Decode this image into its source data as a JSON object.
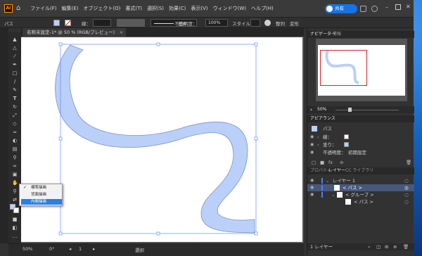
{
  "menubar": {
    "app_logo": "Ai",
    "items": [
      "ファイル(F)",
      "編集(E)",
      "オブジェクト(O)",
      "書式(T)",
      "選択(S)",
      "効果(C)",
      "表示(V)",
      "ウィンドウ(W)",
      "ヘルプ(H)"
    ],
    "share_label": "共有"
  },
  "control": {
    "object_label": "パス",
    "stroke_label": "線：",
    "stroke_style": "基本",
    "opacity_label": "不透明度：",
    "opacity_value": "100%",
    "style_label": "スタイル：",
    "align_label": "整列",
    "transform_label": "変形"
  },
  "document": {
    "tab_title": "名称未設定-1* @ 50 % (RGB/プレビュー)",
    "tab_close": "×"
  },
  "draw_mode_menu": {
    "options": [
      "標準描画",
      "背面描画",
      "内側描画"
    ],
    "checked_index": 0,
    "selected_index": 2
  },
  "status_bar": {
    "zoom": "50%",
    "rotation": "0°",
    "artboard_number": "1",
    "tool_name": "選択"
  },
  "navigator": {
    "tab_navigator": "ナビゲーター",
    "tab_info": "情報",
    "zoom": "50%"
  },
  "appearance": {
    "tab_label": "アピアランス",
    "object_label": "パス",
    "stroke_label": "線：",
    "fill_label": "塗り：",
    "opacity_label": "不透明度：",
    "opacity_value": "初期設定"
  },
  "layers": {
    "tab_properties": "プロパティ",
    "tab_layers": "レイヤー",
    "tab_libraries": "CC ライブラリ",
    "items": [
      {
        "name": "レイヤー 1",
        "level": 0
      },
      {
        "name": "< パス >",
        "level": 1
      },
      {
        "name": "< グループ >",
        "level": 1
      },
      {
        "name": "< パス >",
        "level": 2
      }
    ],
    "footer_label": "1 レイヤー"
  },
  "colors": {
    "shape_fill": "#bad0f8",
    "shape_stroke": "#7b8fc9",
    "selection_accent": "#4a7dff",
    "highlight": "#2680eb"
  }
}
